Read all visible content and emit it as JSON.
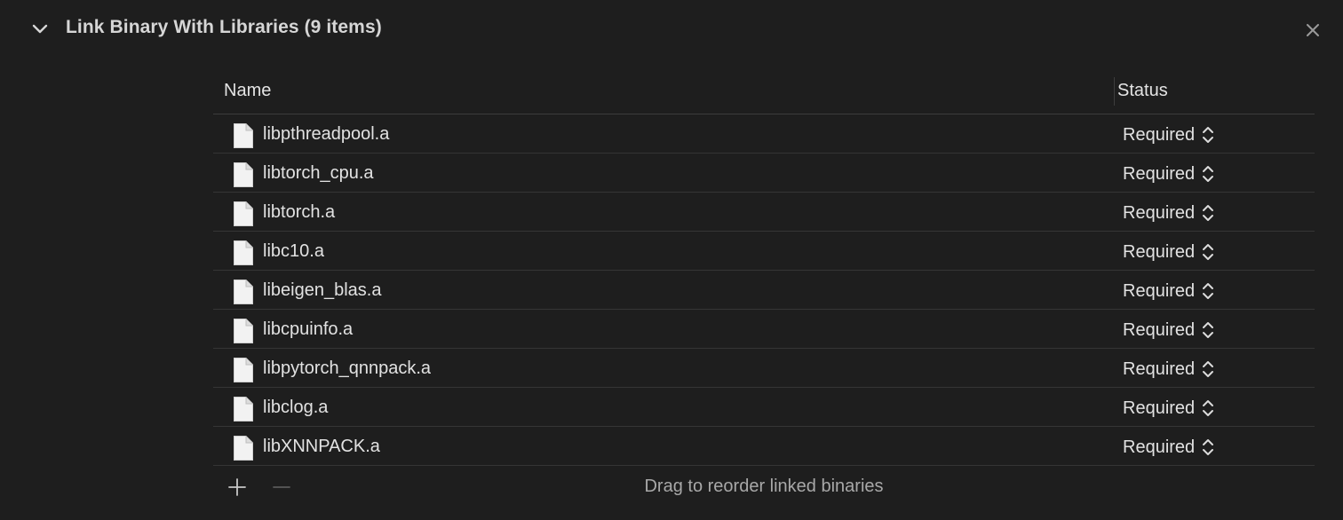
{
  "section": {
    "title": "Link Binary With Libraries (9 items)",
    "expanded": true,
    "disclosure_icon": "chevron-down-icon",
    "close_icon": "close-icon"
  },
  "table": {
    "columns": {
      "name": "Name",
      "status": "Status"
    },
    "rows": [
      {
        "name": "libpthreadpool.a",
        "status": "Required"
      },
      {
        "name": "libtorch_cpu.a",
        "status": "Required"
      },
      {
        "name": "libtorch.a",
        "status": "Required"
      },
      {
        "name": "libc10.a",
        "status": "Required"
      },
      {
        "name": "libeigen_blas.a",
        "status": "Required"
      },
      {
        "name": "libcpuinfo.a",
        "status": "Required"
      },
      {
        "name": "libpytorch_qnnpack.a",
        "status": "Required"
      },
      {
        "name": "libclog.a",
        "status": "Required"
      },
      {
        "name": "libXNNPACK.a",
        "status": "Required"
      }
    ]
  },
  "footer": {
    "add_icon": "plus-icon",
    "remove_icon": "minus-icon",
    "hint": "Drag to reorder linked binaries"
  },
  "colors": {
    "background": "#1e1e1e",
    "text": "#e2e2e2",
    "secondary_text": "#a8a8a8",
    "separator": "#353535"
  }
}
